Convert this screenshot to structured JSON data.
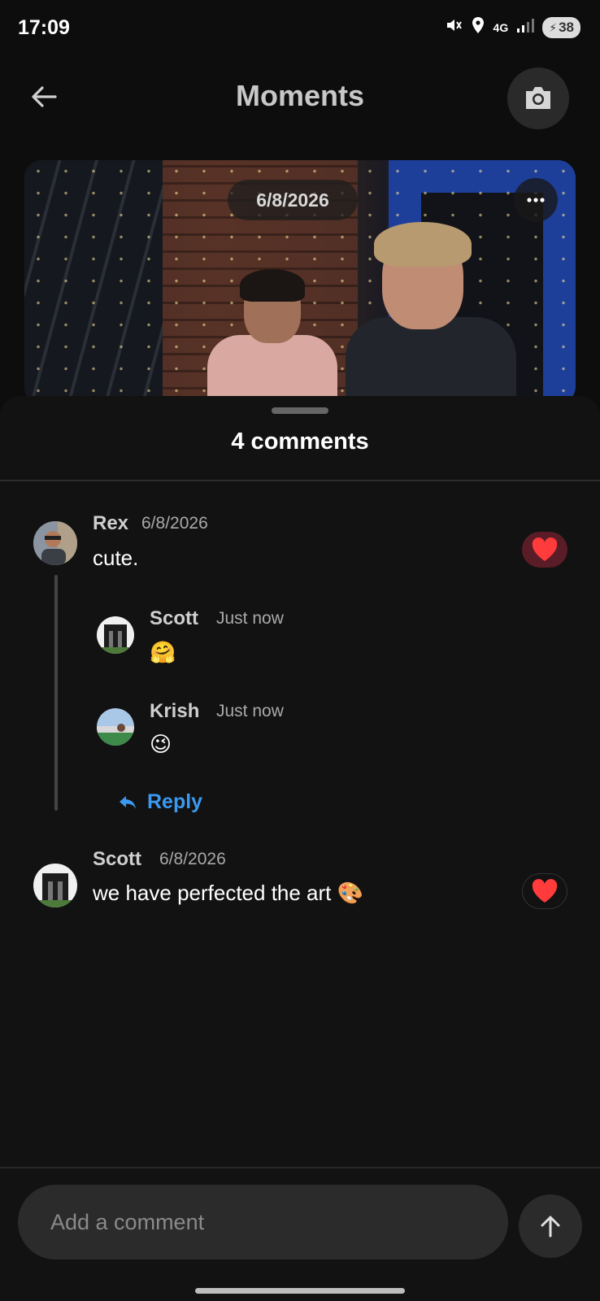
{
  "status_bar": {
    "time": "17:09",
    "network": "4G",
    "battery": "38"
  },
  "header": {
    "title": "Moments",
    "back_icon": "arrow-left-icon",
    "camera_icon": "camera-icon"
  },
  "photo": {
    "date": "6/8/2026",
    "more_icon": "more-horizontal-icon"
  },
  "sheet": {
    "title": "4 comments"
  },
  "comments": [
    {
      "name": "Rex",
      "time": "6/8/2026",
      "text": "cute.",
      "liked": true,
      "replies": [
        {
          "name": "Scott",
          "time": "Just now",
          "text": "🤗"
        },
        {
          "name": "Krish",
          "time": "Just now",
          "text": "😉"
        }
      ],
      "reply_label": "Reply"
    },
    {
      "name": "Scott",
      "time": "6/8/2026",
      "text": "we have perfected the art 🎨",
      "liked": true
    }
  ],
  "composer": {
    "placeholder": "Add a comment",
    "send_icon": "arrow-up-icon"
  },
  "colors": {
    "accent": "#3b9af0",
    "like": "#ff3b3b",
    "like_bg": "#5a1d27"
  }
}
